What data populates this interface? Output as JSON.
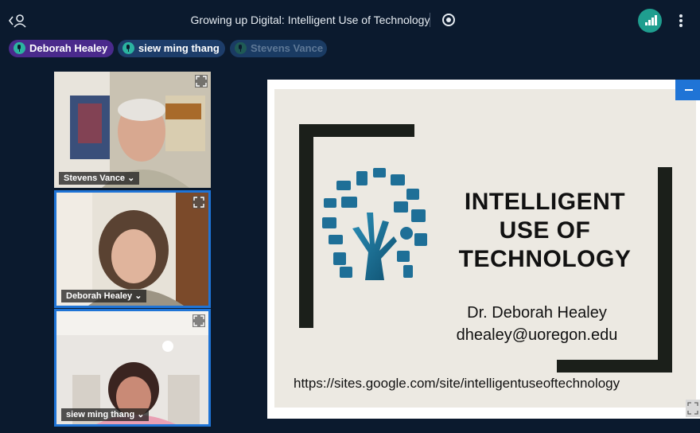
{
  "meeting": {
    "title": "Growing up Digital: Intelligent Use of Technology"
  },
  "icons": {
    "back": "back-profile-icon",
    "record": "record-icon",
    "signal": "signal-strength-icon",
    "more": "more-vertical-icon",
    "mic": "microphone-icon",
    "expand": "expand-icon",
    "minimize": "minimize-icon",
    "chevron": "chevron-down-icon"
  },
  "colors": {
    "background": "#0b1a2e",
    "accent": "#1f74d6",
    "teal": "#1f9e8f",
    "pill_active": "#4a2a8c",
    "pill_dim": "#1d3d6a"
  },
  "participants_bar": [
    {
      "name": "Deborah Healey",
      "speaking": true
    },
    {
      "name": "siew ming thang",
      "speaking": true
    },
    {
      "name": "Stevens Vance",
      "speaking": false
    }
  ],
  "video_tiles": [
    {
      "name": "Stevens Vance",
      "chevron": "⌄"
    },
    {
      "name": "Deborah Healey",
      "chevron": "⌄"
    },
    {
      "name": "siew ming thang",
      "chevron": "⌄"
    }
  ],
  "slide": {
    "title_lines": [
      "INTELLIGENT",
      "USE OF",
      "TECHNOLOGY"
    ],
    "author": "Dr. Deborah Healey",
    "email": "dhealey@uoregon.edu",
    "url": "https://sites.google.com/site/intelligentuseoftechnology"
  }
}
